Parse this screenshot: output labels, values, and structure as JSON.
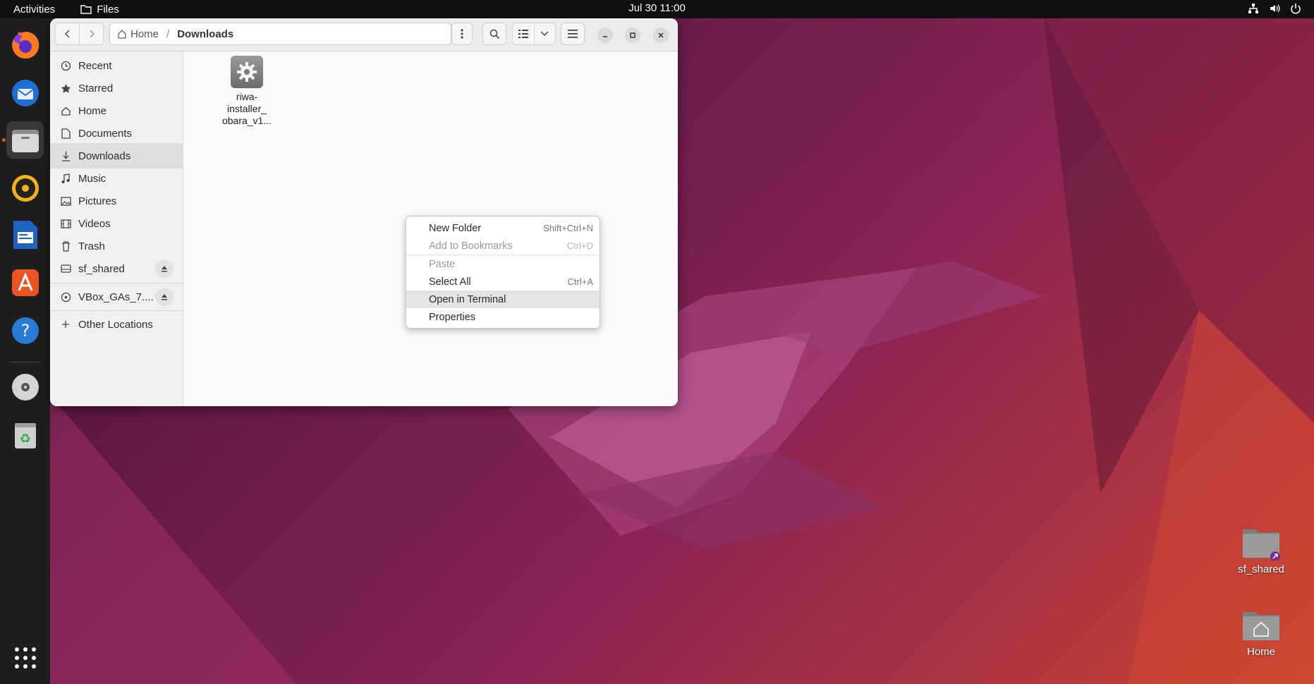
{
  "topbar": {
    "activities": "Activities",
    "app_name": "Files",
    "clock": "Jul 30  11:00"
  },
  "dock": {
    "items": [
      "firefox",
      "thunderbird",
      "files",
      "rhythmbox",
      "libreoffice-writer",
      "app-center",
      "help",
      "dvd",
      "trash",
      "show-apps"
    ]
  },
  "window": {
    "path": {
      "home": "Home",
      "separator": "/",
      "current": "Downloads"
    },
    "sidebar": {
      "items": [
        {
          "label": "Recent",
          "icon": "clock-icon"
        },
        {
          "label": "Starred",
          "icon": "star-icon"
        },
        {
          "label": "Home",
          "icon": "home-icon"
        },
        {
          "label": "Documents",
          "icon": "document-icon"
        },
        {
          "label": "Downloads",
          "icon": "download-icon"
        },
        {
          "label": "Music",
          "icon": "music-icon"
        },
        {
          "label": "Pictures",
          "icon": "picture-icon"
        },
        {
          "label": "Videos",
          "icon": "video-icon"
        },
        {
          "label": "Trash",
          "icon": "trash-icon"
        },
        {
          "label": "sf_shared",
          "icon": "drive-icon"
        },
        {
          "label": "VBox_GAs_7....",
          "icon": "disc-icon"
        },
        {
          "label": "Other Locations",
          "icon": "plus-icon"
        }
      ]
    },
    "files": [
      {
        "name_lines": [
          "riwa-",
          "installer_",
          "obara_v1..."
        ]
      }
    ]
  },
  "context_menu": {
    "items": [
      {
        "label": "New Folder",
        "accel": "Shift+Ctrl+N",
        "state": "enabled"
      },
      {
        "label": "Add to Bookmarks",
        "accel": "Ctrl+D",
        "state": "disabled"
      },
      {
        "label": "Paste",
        "accel": "",
        "state": "disabled"
      },
      {
        "label": "Select All",
        "accel": "Ctrl+A",
        "state": "enabled"
      },
      {
        "label": "Open in Terminal",
        "accel": "",
        "state": "hover"
      },
      {
        "label": "Properties",
        "accel": "",
        "state": "enabled"
      }
    ]
  },
  "desktop": {
    "icons": [
      {
        "label": "sf_shared"
      },
      {
        "label": "Home"
      }
    ]
  },
  "colors": {
    "accent": "#e95420",
    "topbar": "#101010",
    "dock": "#1e1e1e"
  }
}
